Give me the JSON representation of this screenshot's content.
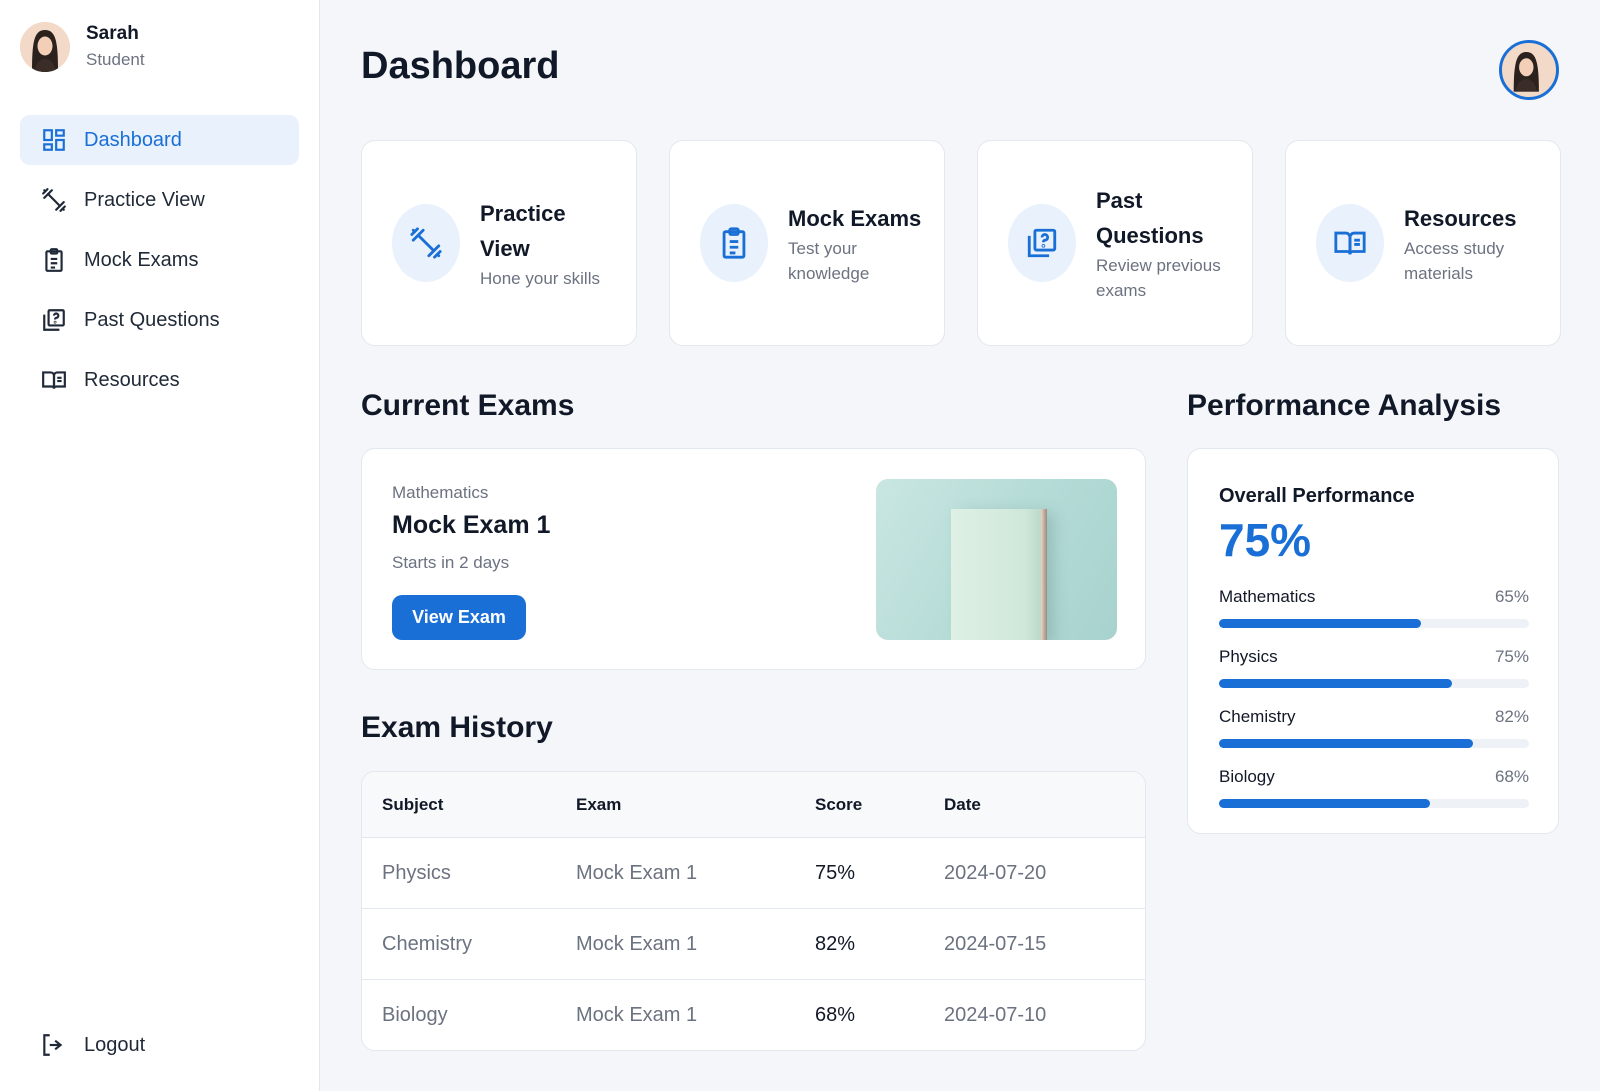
{
  "user": {
    "name": "Sarah",
    "role": "Student"
  },
  "sidebar": {
    "items": [
      {
        "label": "Dashboard",
        "icon": "dashboard-icon",
        "active": true
      },
      {
        "label": "Practice View",
        "icon": "dumbbell-icon"
      },
      {
        "label": "Mock Exams",
        "icon": "clipboard-icon"
      },
      {
        "label": "Past Questions",
        "icon": "question-library-icon"
      },
      {
        "label": "Resources",
        "icon": "book-icon"
      }
    ],
    "logout_label": "Logout"
  },
  "header": {
    "title": "Dashboard"
  },
  "cards": [
    {
      "title": "Practice View",
      "subtitle": "Hone your skills",
      "icon": "dumbbell-icon"
    },
    {
      "title": "Mock Exams",
      "subtitle": "Test your knowledge",
      "icon": "clipboard-icon"
    },
    {
      "title": "Past Questions",
      "subtitle": "Review previous exams",
      "icon": "question-library-icon"
    },
    {
      "title": "Resources",
      "subtitle": "Access study materials",
      "icon": "book-icon"
    }
  ],
  "current_exams": {
    "heading": "Current Exams",
    "subject": "Mathematics",
    "title": "Mock Exam 1",
    "starts": "Starts in 2 days",
    "button": "View Exam"
  },
  "history": {
    "heading": "Exam History",
    "columns": [
      "Subject",
      "Exam",
      "Score",
      "Date"
    ],
    "rows": [
      [
        "Physics",
        "Mock Exam 1",
        "75%",
        "2024-07-20"
      ],
      [
        "Chemistry",
        "Mock Exam 1",
        "82%",
        "2024-07-15"
      ],
      [
        "Biology",
        "Mock Exam 1",
        "68%",
        "2024-07-10"
      ]
    ]
  },
  "performance": {
    "heading": "Performance Analysis",
    "overall_label": "Overall Performance",
    "overall_value": "75%",
    "subjects": [
      {
        "name": "Mathematics",
        "pct": "65%",
        "value": 65
      },
      {
        "name": "Physics",
        "pct": "75%",
        "value": 75
      },
      {
        "name": "Chemistry",
        "pct": "82%",
        "value": 82
      },
      {
        "name": "Biology",
        "pct": "68%",
        "value": 68
      }
    ]
  },
  "colors": {
    "accent": "#1a6fd6",
    "active_bg": "#e8f1fc",
    "background": "#f4f6f9"
  }
}
